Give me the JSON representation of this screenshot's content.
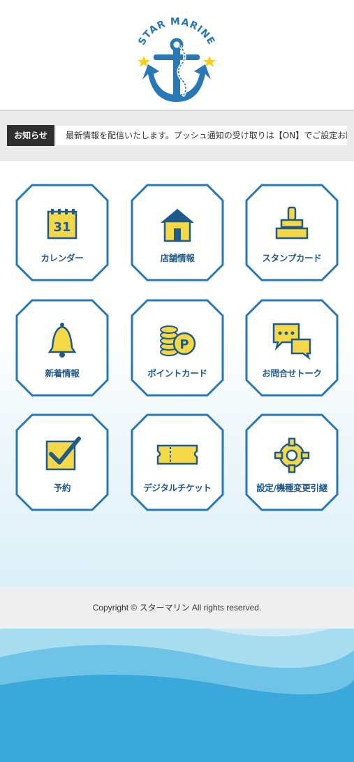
{
  "brand": {
    "name": "STAR MARINE"
  },
  "notice": {
    "label": "お知らせ",
    "text": "最新情報を配信いたします。プッシュ通知の受け取りは【ON】でご設定お願いします。"
  },
  "menu": [
    {
      "label": "カレンダー",
      "icon": "calendar-icon",
      "icon_text": "31"
    },
    {
      "label": "店舗情報",
      "icon": "store-icon"
    },
    {
      "label": "スタンプカード",
      "icon": "stamp-icon"
    },
    {
      "label": "新着情報",
      "icon": "bell-icon"
    },
    {
      "label": "ポイントカード",
      "icon": "coins-point-icon",
      "icon_text": "P"
    },
    {
      "label": "お問合せトーク",
      "icon": "chat-icon"
    },
    {
      "label": "予約",
      "icon": "checkbox-icon"
    },
    {
      "label": "デジタルチケット",
      "icon": "ticket-icon"
    },
    {
      "label": "設定/機種変更引継",
      "icon": "gear-icon"
    }
  ],
  "footer": {
    "copyright": "Copyright © スターマリン All rights reserved."
  },
  "colors": {
    "primary_blue": "#2878b8",
    "icon_yellow": "#f5d848",
    "tile_text": "#1f5a8a"
  }
}
